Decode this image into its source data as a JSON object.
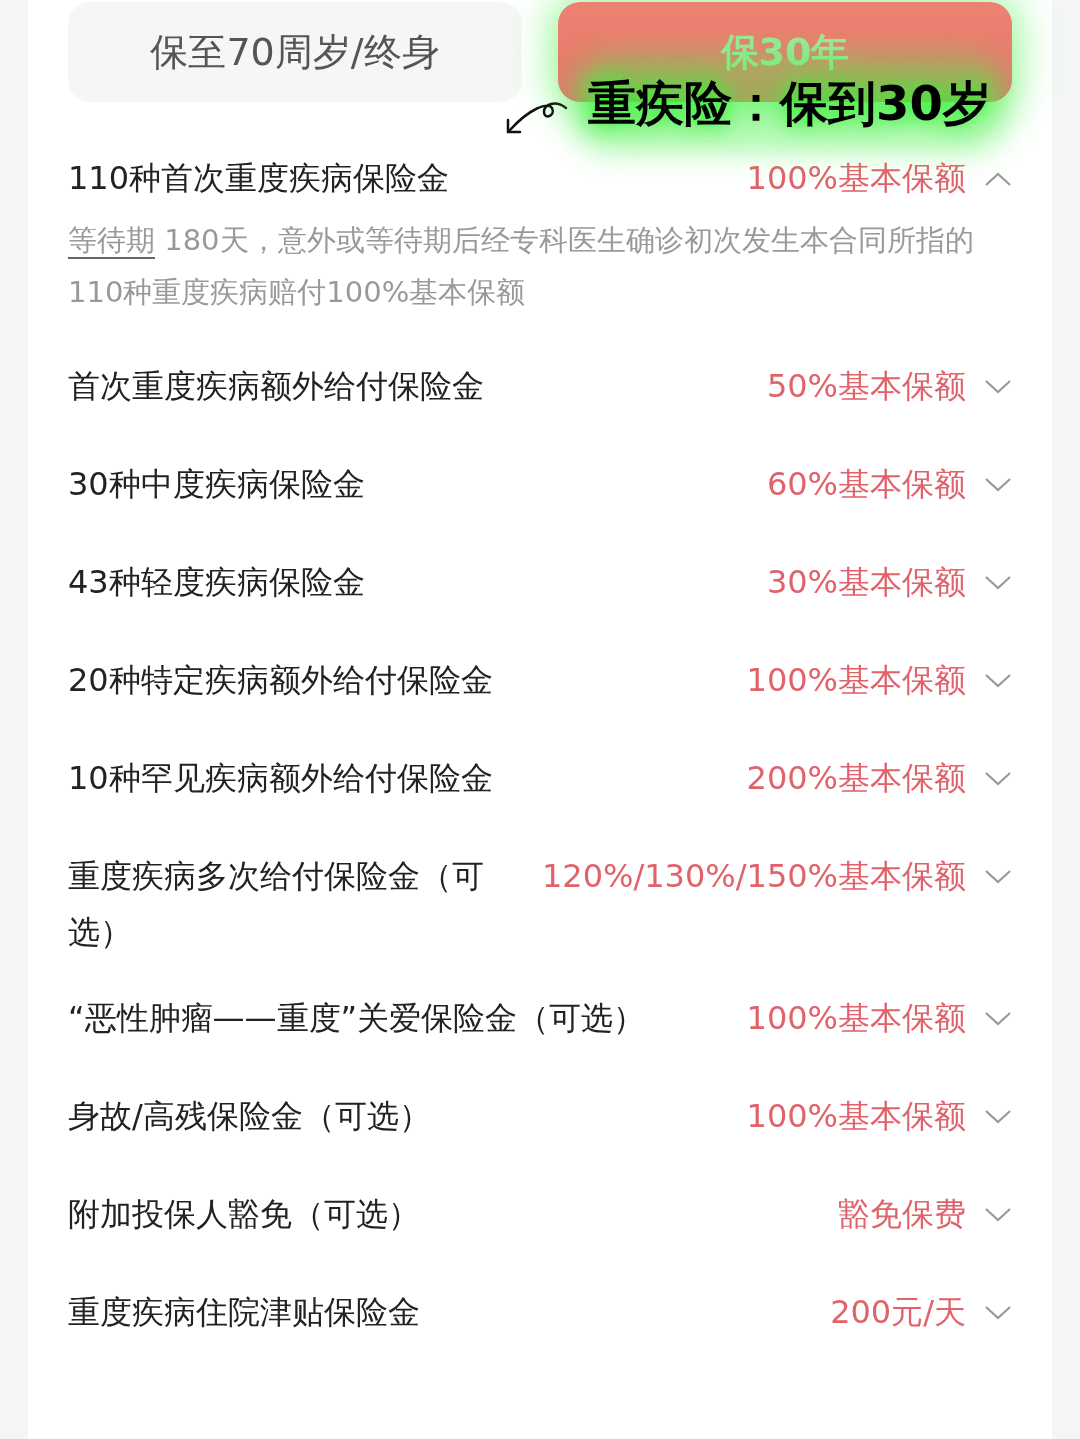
{
  "tabs": [
    {
      "label": "保至70周岁/终身",
      "selected": false
    },
    {
      "label": "保30年",
      "selected": true
    }
  ],
  "annotation": {
    "text": "重疾险：保到30岁"
  },
  "benefits": [
    {
      "name": "110种首次重度疾病保险金",
      "amount": "100%基本保额",
      "expanded": true,
      "description": {
        "term": "等待期",
        "text": " 180天，意外或等待期后经专科医生确诊初次发生本合同所指的110种重度疾病赔付100%基本保额"
      }
    },
    {
      "name": "首次重度疾病额外给付保险金",
      "amount": "50%基本保额",
      "expanded": false
    },
    {
      "name": "30种中度疾病保险金",
      "amount": "60%基本保额",
      "expanded": false
    },
    {
      "name": "43种轻度疾病保险金",
      "amount": "30%基本保额",
      "expanded": false
    },
    {
      "name": "20种特定疾病额外给付保险金",
      "amount": "100%基本保额",
      "expanded": false
    },
    {
      "name": "10种罕见疾病额外给付保险金",
      "amount": "200%基本保额",
      "expanded": false
    },
    {
      "name": "重度疾病多次给付保险金（可选）",
      "amount": "120%/130%/150%基本保额",
      "expanded": false
    },
    {
      "name": "“恶性肿瘤——重度”关爱保险金（可选）",
      "amount": "100%基本保额",
      "expanded": false
    },
    {
      "name": "身故/高残保险金（可选）",
      "amount": "100%基本保额",
      "expanded": false
    },
    {
      "name": "附加投保人豁免（可选）",
      "amount": "豁免保费",
      "expanded": false
    },
    {
      "name": "重度疾病住院津贴保险金",
      "amount": "200元/天",
      "expanded": false
    }
  ]
}
